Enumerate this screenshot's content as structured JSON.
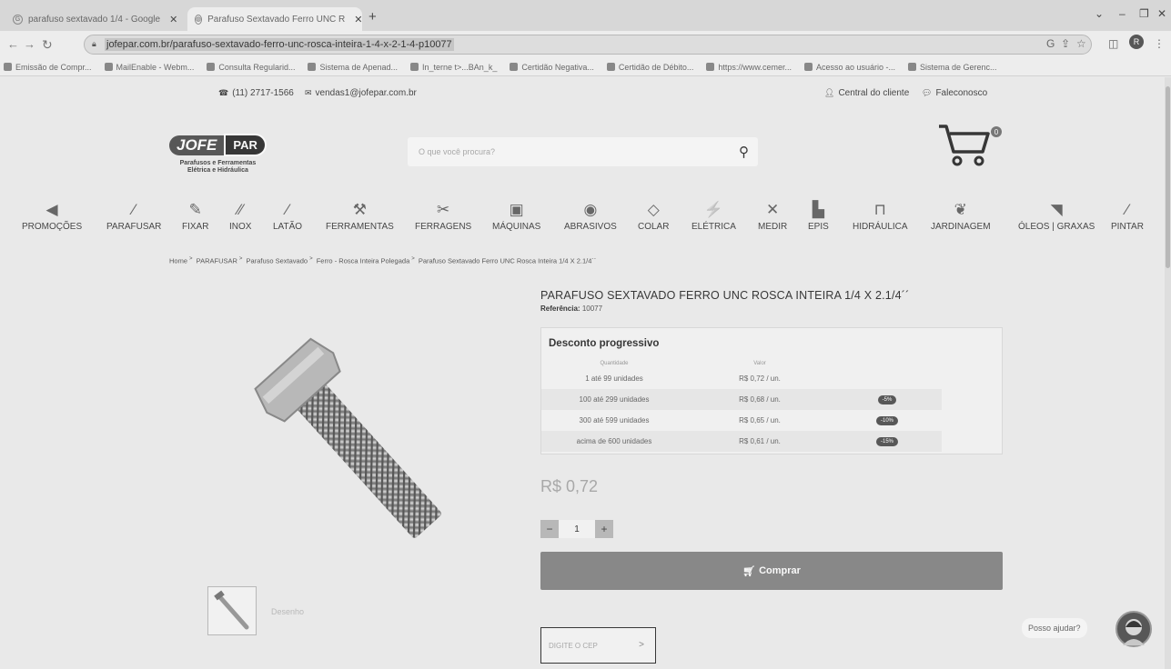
{
  "tabs": [
    {
      "title": "parafuso sextavado 1/4 - Google",
      "favicon": "G"
    },
    {
      "title": "Parafuso Sextavado Ferro UNC R",
      "favicon": "◍"
    }
  ],
  "browser": {
    "url": "jofepar.com.br/parafuso-sextavado-ferro-unc-rosca-inteira-1-4-x-2-1-4-p10077",
    "profile_initial": "R"
  },
  "bookmarks": [
    "Emissão de Compr...",
    "MailEnable - Webm...",
    "Consulta Regularid...",
    "Sistema de Apenad...",
    "In_terne t>...BAn_k_",
    "Certidão Negativa...",
    "Certidão de Débito...",
    "https://www.cemer...",
    "Acesso ao usuário -...",
    "Sistema de Gerenc..."
  ],
  "header": {
    "phone": "(11) 2717-1566",
    "email": "vendas1@jofepar.com.br",
    "customer_center": "Central do cliente",
    "contact": "Faleconosco",
    "logo_left": "JOFE",
    "logo_right": "PAR",
    "logo_tagline_1": "Parafusos e Ferramentas",
    "logo_tagline_2": "Elétrica e Hidráulica",
    "search_placeholder": "O que você procura?",
    "cart_count": "0"
  },
  "categories": [
    {
      "label": "PROMOÇÕES",
      "icon": "◀"
    },
    {
      "label": "PARAFUSAR",
      "icon": "⁄"
    },
    {
      "label": "FIXAR",
      "icon": "✎"
    },
    {
      "label": "INOX",
      "icon": "⁄⁄"
    },
    {
      "label": "LATÃO",
      "icon": "⁄"
    },
    {
      "label": "FERRAMENTAS",
      "icon": "⚒"
    },
    {
      "label": "FERRAGENS",
      "icon": "✂"
    },
    {
      "label": "MÁQUINAS",
      "icon": "▣"
    },
    {
      "label": "ABRASIVOS",
      "icon": "◉"
    },
    {
      "label": "COLAR",
      "icon": "◇"
    },
    {
      "label": "ELÉTRICA",
      "icon": "⚡"
    },
    {
      "label": "MEDIR",
      "icon": "✕"
    },
    {
      "label": "EPIS",
      "icon": "▙"
    },
    {
      "label": "HIDRÁULICA",
      "icon": "⊓"
    },
    {
      "label": "JARDINAGEM",
      "icon": "❦"
    },
    {
      "label": "ÓLEOS | GRAXAS",
      "icon": "◥"
    },
    {
      "label": "PINTAR",
      "icon": "⁄"
    }
  ],
  "breadcrumb": [
    "Home",
    "PARAFUSAR",
    "Parafuso Sextavado",
    "Ferro - Rosca Inteira Polegada",
    "Parafuso Sextavado Ferro UNC Rosca Inteira 1/4 X 2.1/4´´"
  ],
  "product": {
    "title": "PARAFUSO SEXTAVADO FERRO UNC ROSCA INTEIRA 1/4 X 2.1/4´´",
    "reference_label": "Referência:",
    "reference_value": "10077",
    "thumb_caption": "Desenho",
    "price": "R$ 0,72",
    "quantity": "1",
    "buy_label": "Comprar",
    "cep_placeholder": "DIGITE O CEP"
  },
  "discount": {
    "title": "Desconto progressivo",
    "col_qty": "Quantidade",
    "col_value": "Valor",
    "rows": [
      {
        "qty": "1 até 99 unidades",
        "value": "R$ 0,72 / un.",
        "badge": ""
      },
      {
        "qty": "100 até 299 unidades",
        "value": "R$ 0,68 / un.",
        "badge": "-5%"
      },
      {
        "qty": "300 até 599 unidades",
        "value": "R$ 0,65 / un.",
        "badge": "-10%"
      },
      {
        "qty": "acima de 600 unidades",
        "value": "R$ 0,61 / un.",
        "badge": "-15%"
      }
    ]
  },
  "chat": {
    "help_text": "Posso ajudar?"
  }
}
